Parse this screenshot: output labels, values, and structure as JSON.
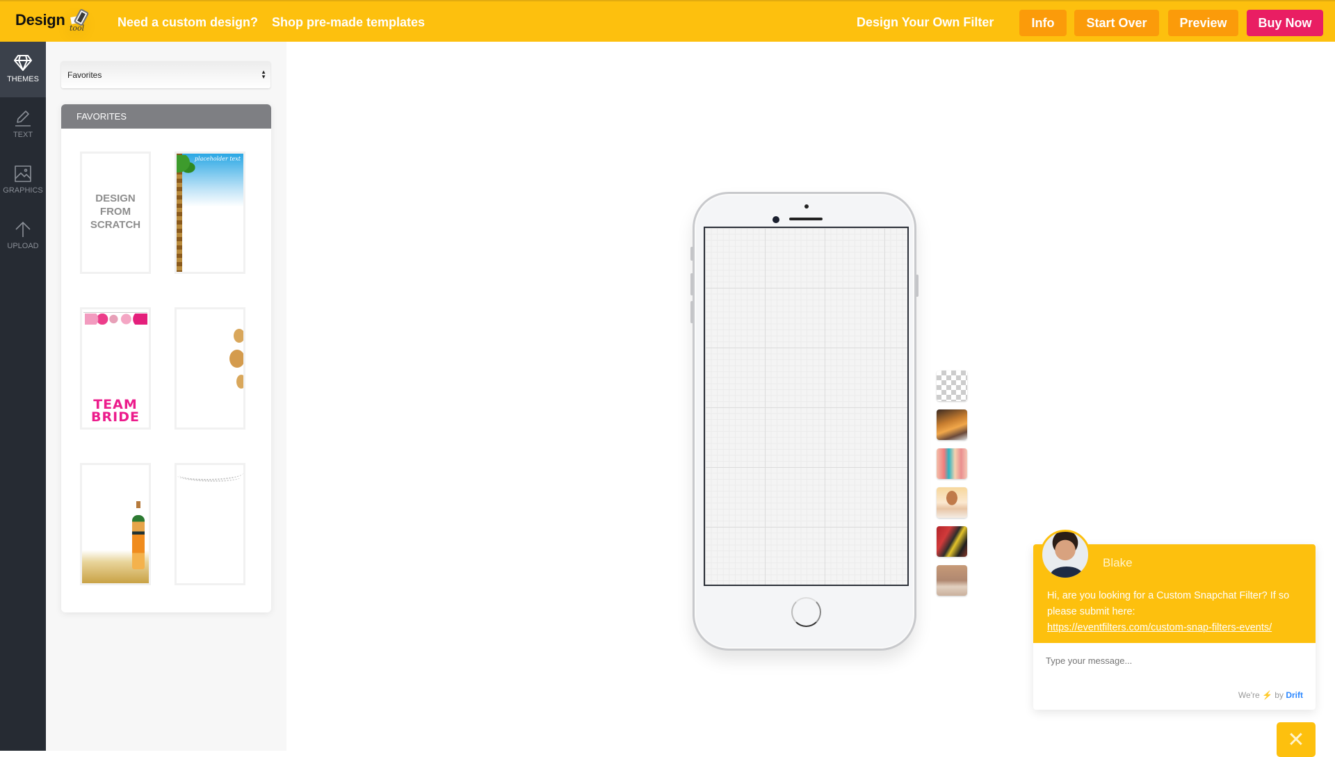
{
  "header": {
    "logo_text": "Design",
    "logo_subtext": "tool",
    "nav_links": [
      "Need a custom design?",
      "Shop pre-made templates"
    ],
    "design_filter_label": "Design Your Own Filter",
    "buttons": {
      "info": "Info",
      "start_over": "Start Over",
      "preview": "Preview",
      "buy_now": "Buy Now"
    },
    "colors": {
      "bar": "#fdc00e",
      "button": "#fb9b0a",
      "buy": "#e91e63"
    }
  },
  "sidebar": {
    "items": [
      {
        "label": "THEMES",
        "icon": "diamond-icon",
        "active": true
      },
      {
        "label": "TEXT",
        "icon": "pencil-icon",
        "active": false
      },
      {
        "label": "GRAPHICS",
        "icon": "image-icon",
        "active": false
      },
      {
        "label": "UPLOAD",
        "icon": "upload-arrow-icon",
        "active": false
      }
    ]
  },
  "themes_panel": {
    "category_select": {
      "value": "Favorites"
    },
    "section_title": "FAVORITES",
    "templates": [
      {
        "name": "design-from-scratch",
        "text": "DESIGN FROM SCRATCH"
      },
      {
        "name": "palm-tree",
        "text": "placeholder text"
      },
      {
        "name": "team-bride",
        "text": "TEAM BRIDE"
      },
      {
        "name": "gold-balloons",
        "text": ""
      },
      {
        "name": "champagne",
        "text": ""
      },
      {
        "name": "string-lights",
        "text": ""
      }
    ]
  },
  "canvas": {
    "backgrounds": [
      {
        "name": "transparent"
      },
      {
        "name": "restaurant-photo"
      },
      {
        "name": "party-girls-photo"
      },
      {
        "name": "birthday-girl-photo"
      },
      {
        "name": "dancing-photo"
      },
      {
        "name": "wedding-feet-photo"
      }
    ]
  },
  "chat": {
    "agent_name": "Blake",
    "message": "Hi, are you looking for a Custom Snapchat Filter? If so please submit here:",
    "link_text": "https://eventfilters.com/custom-snap-filters-events/",
    "input_placeholder": "Type your message...",
    "credit_prefix": "We're",
    "credit_bolt": "⚡",
    "credit_by": "by",
    "credit_brand": "Drift",
    "close_glyph": "✕"
  }
}
